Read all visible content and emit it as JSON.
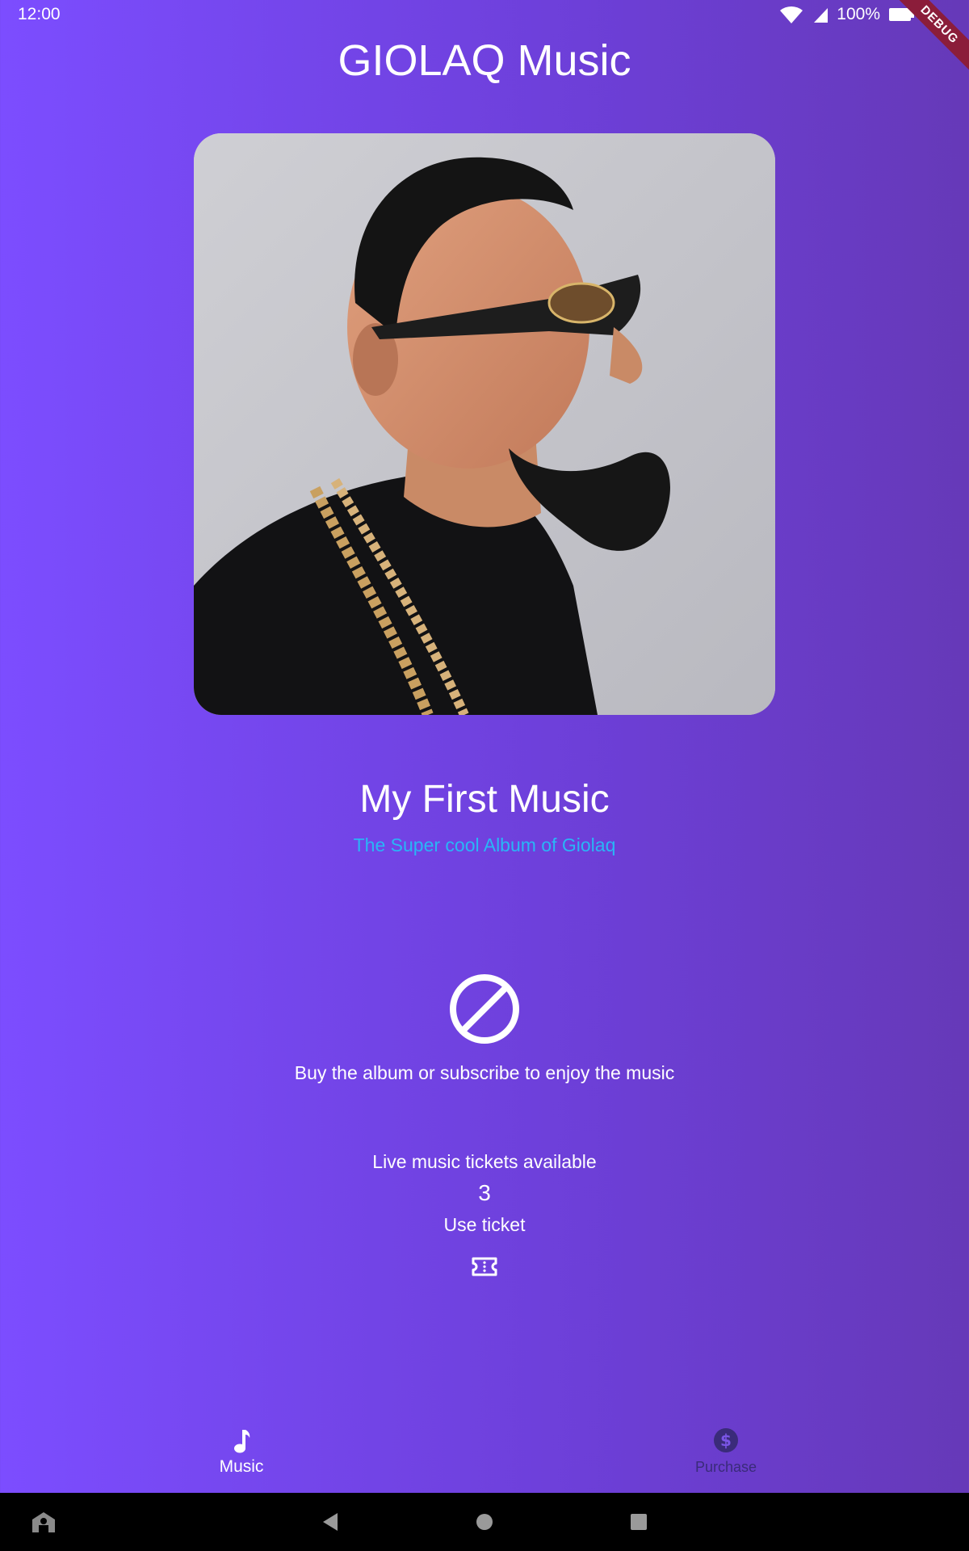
{
  "status_bar": {
    "time": "12:00",
    "battery": "100%",
    "icons": [
      "wifi-icon",
      "signal-icon",
      "battery-icon"
    ],
    "debug_banner": "DEBUG"
  },
  "header": {
    "title": "GIOLAQ Music"
  },
  "album": {
    "image_icon": "album-cover-portrait"
  },
  "track": {
    "title": "My First Music",
    "subtitle": "The Super cool Album of Giolaq"
  },
  "access": {
    "icon": "block-icon",
    "message": "Buy the album or subscribe to enjoy the music"
  },
  "tickets": {
    "label": "Live music tickets available",
    "count": "3",
    "use_label": "Use ticket",
    "icon": "ticket-icon"
  },
  "bottom_nav": {
    "items": [
      {
        "label": "Music",
        "icon": "music-note-icon",
        "active": true
      },
      {
        "label": "Purchase",
        "icon": "dollar-circle-icon",
        "active": false
      }
    ]
  },
  "system_nav": {
    "buttons": [
      "accessibility-icon",
      "back-icon",
      "home-icon",
      "recents-icon"
    ]
  },
  "colors": {
    "gradient_start": "#7c4dff",
    "gradient_end": "#6639b8",
    "subtitle": "#29b6f6",
    "inactive_nav": "#3a2b7a"
  }
}
